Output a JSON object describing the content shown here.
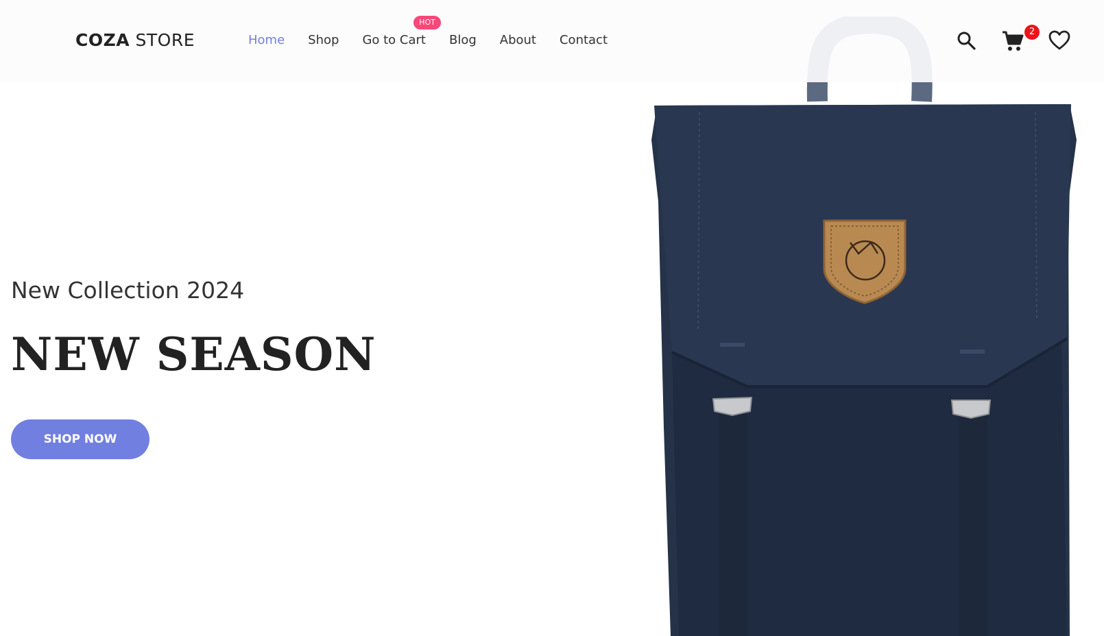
{
  "header": {
    "logo_bold": "COZA",
    "logo_light": " STORE",
    "nav": [
      {
        "label": "Home",
        "active": true
      },
      {
        "label": "Shop",
        "active": false
      },
      {
        "label": "Go to Cart",
        "active": false
      },
      {
        "label": "Blog",
        "active": false
      },
      {
        "label": "About",
        "active": false
      },
      {
        "label": "Contact",
        "active": false
      }
    ],
    "hot_badge": "HOT",
    "icons": [
      "search-icon",
      "cart-icon",
      "heart-icon"
    ],
    "cart_count": "2"
  },
  "hero": {
    "subtitle": "New Collection 2024",
    "title": "NEW SEASON",
    "cta": "SHOP NOW"
  },
  "colors": {
    "accent": "#717fe0",
    "hot": "#f74877",
    "badge_red": "#e8151b",
    "backpack_navy": "#253248"
  }
}
